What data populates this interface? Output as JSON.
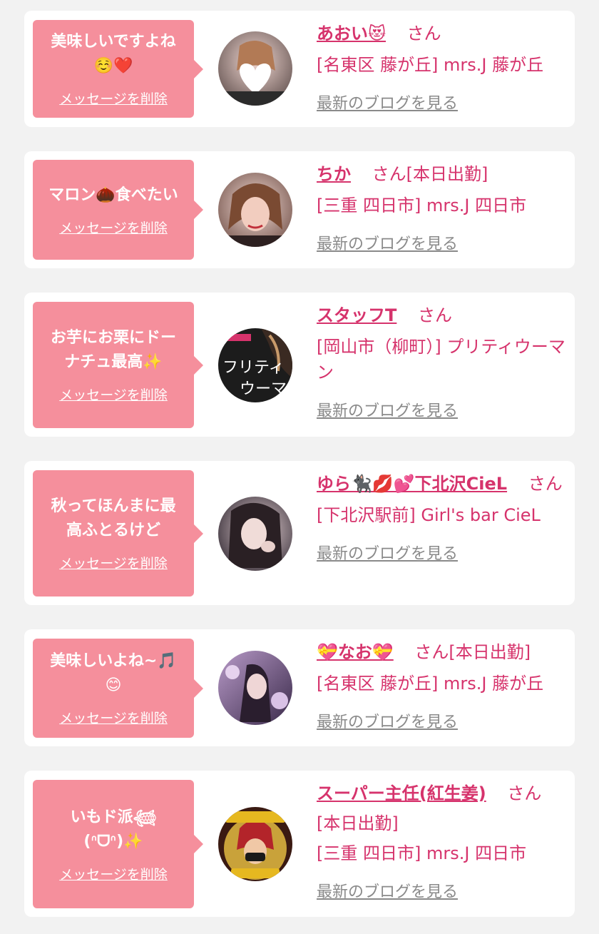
{
  "colors": {
    "bubble": "#f58f9c",
    "accent": "#d6336c",
    "link_gray": "#8a8a8a",
    "background": "#f2f2f2"
  },
  "entries": [
    {
      "message": "美味しいですよね\n☺️❤️",
      "delete_label": "メッセージを削除",
      "name": "あおい😻",
      "suffix": "さん",
      "store": "[名東区 藤が丘] mrs.J 藤が丘",
      "blog_label": "最新のブログを見る"
    },
    {
      "message": "マロン🌰食べたい",
      "delete_label": "メッセージを削除",
      "name": "ちか",
      "suffix": "さん[本日出勤]",
      "store": "[三重 四日市] mrs.J 四日市",
      "blog_label": "最新のブログを見る"
    },
    {
      "message": "お芋にお栗にドー\nナチュ最高✨",
      "delete_label": "メッセージを削除",
      "name": "スタッフT",
      "suffix": "さん",
      "store": "[岡山市（柳町）] プリティウーマン",
      "blog_label": "最新のブログを見る"
    },
    {
      "message": "秋ってほんまに最\n高ふとるけど",
      "delete_label": "メッセージを削除",
      "name": "ゆら🐈‍⬛💋💕下北沢CieL",
      "suffix": "さん",
      "store": "[下北沢駅前] Girl's bar CieL",
      "blog_label": "最新のブログを見る"
    },
    {
      "message": "美味しいよね~🎵\n😊",
      "delete_label": "メッセージを削除",
      "name": "💝なお💝",
      "suffix": "さん[本日出勤]",
      "store": "[名東区 藤が丘] mrs.J 藤が丘",
      "blog_label": "最新のブログを見る"
    },
    {
      "message": "いもド派𓆉\n(ᐢᗜᐢ)✨",
      "delete_label": "メッセージを削除",
      "name": "スーパー主任(紅生姜)",
      "suffix": "さん",
      "status": "[本日出勤]",
      "store": "[三重 四日市] mrs.J 四日市",
      "blog_label": "最新のブログを見る"
    }
  ]
}
